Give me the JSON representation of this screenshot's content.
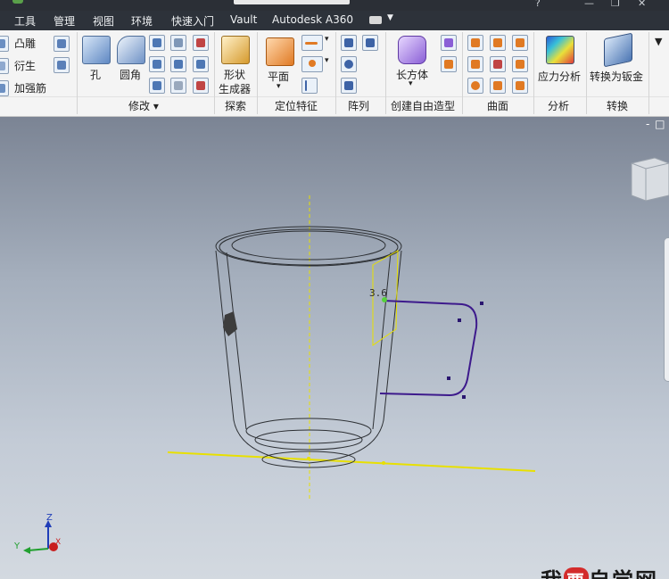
{
  "menubar": {
    "tabs": [
      "工具",
      "管理",
      "视图",
      "环境",
      "快速入门",
      "Vault",
      "Autodesk A360"
    ]
  },
  "ribbon": {
    "left_items": [
      "凸雕",
      "衍生",
      "加强筋"
    ],
    "hole_label": "孔",
    "fillet_label": "圆角",
    "shape_gen": [
      "形状",
      "生成器"
    ],
    "plane_label": "平面",
    "box_label": "长方体",
    "stress_label": "应力分析",
    "sheet_label": "转换为钣金",
    "panel_titles": {
      "modify": "修改",
      "explore": "探索",
      "work_features": "定位特征",
      "pattern": "阵列",
      "freeform": "创建自由造型",
      "surface": "曲面",
      "analysis": "分析",
      "convert": "转换"
    }
  },
  "viewport": {
    "dimension_text": "3.6",
    "axis_z": "Z",
    "axis_y": "Y",
    "axis_x": "X",
    "watermark_pre": "我",
    "watermark_red": "要",
    "watermark_post": "自学网"
  },
  "colors": {
    "accent_yellow": "#e8e000",
    "sketch_purple": "#3d1a8c",
    "ribbon_bg": "#f4f4f4",
    "menubar_bg": "#2d323a"
  }
}
